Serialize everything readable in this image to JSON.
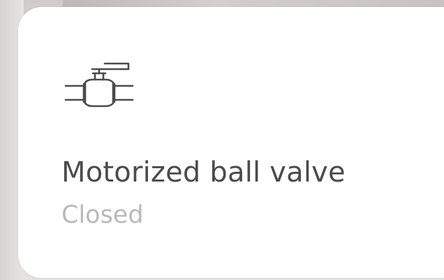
{
  "device_card": {
    "icon": "ball-valve-icon",
    "title": "Motorized ball valve",
    "status": "Closed"
  },
  "colors": {
    "card_background": "#ffffff",
    "title_text": "#4b4b4b",
    "status_text": "#b9b9b9",
    "icon_stroke": "#4b4b4b"
  }
}
